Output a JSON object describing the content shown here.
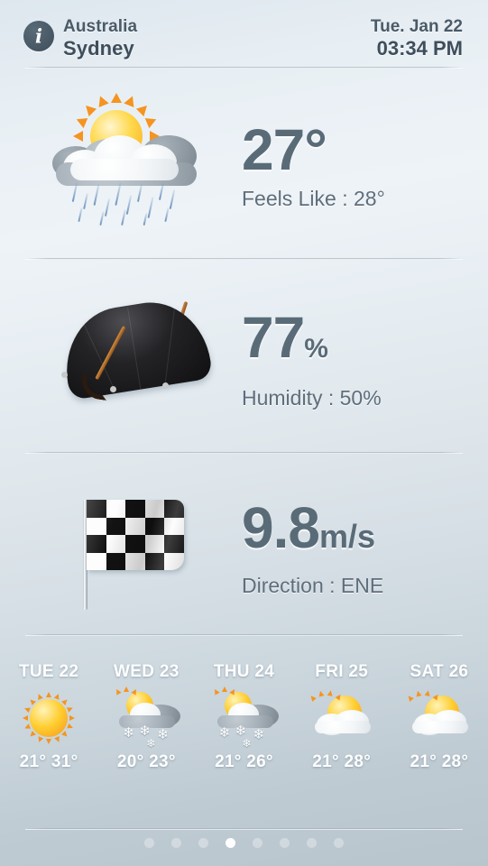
{
  "header": {
    "info_icon": "info-icon",
    "info_glyph": "i",
    "country": "Australia",
    "city": "Sydney",
    "date": "Tue. Jan 22",
    "time": "03:34 PM"
  },
  "metrics": [
    {
      "id": "temperature",
      "icon": "sun-behind-rain-cloud-icon",
      "value": "27°",
      "unit": "",
      "sub": "Feels Like : 28°"
    },
    {
      "id": "humidity",
      "icon": "umbrella-icon",
      "value": "77",
      "unit": "%",
      "sub": "Humidity : 50%"
    },
    {
      "id": "wind",
      "icon": "checkered-flag-icon",
      "value": "9.8",
      "unit": "m/s",
      "sub": "Direction : ENE"
    }
  ],
  "forecast": [
    {
      "label": "TUE 22",
      "icon": "sun-icon",
      "low": "21°",
      "high": "31°",
      "temps": "21° 31°"
    },
    {
      "label": "WED 23",
      "icon": "sun-cloud-snow-icon",
      "low": "20°",
      "high": "23°",
      "temps": "20° 23°"
    },
    {
      "label": "THU 24",
      "icon": "sun-cloud-snow-icon",
      "low": "21°",
      "high": "26°",
      "temps": "21° 26°"
    },
    {
      "label": "FRI 25",
      "icon": "sun-behind-cloud-icon",
      "low": "21°",
      "high": "28°",
      "temps": "21° 28°"
    },
    {
      "label": "SAT 26",
      "icon": "sun-behind-cloud-icon",
      "low": "21°",
      "high": "28°",
      "temps": "21° 28°"
    }
  ],
  "pager": {
    "count": 8,
    "active_index": 3
  },
  "colors": {
    "text_primary": "#3e4e5b",
    "text_secondary": "#5a6b78",
    "accent_sun": "#ffcd2e",
    "background_top": "#e8eff4",
    "background_bottom": "#b8c5cd"
  }
}
